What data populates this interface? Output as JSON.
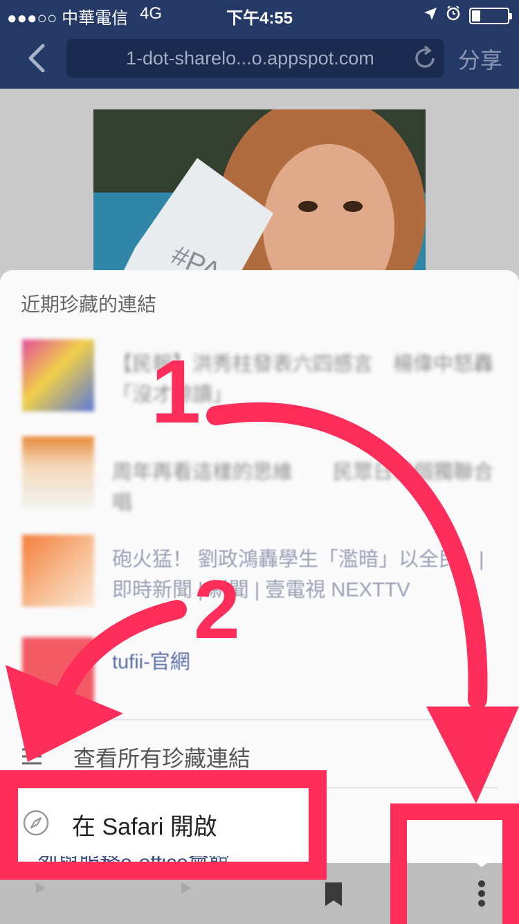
{
  "status_bar": {
    "carrier": "●●●○○ 中華電信",
    "network": "4G",
    "time": "下午4:55"
  },
  "nav": {
    "url": "1-dot-sharelo...o.appspot.com",
    "share_label": "分享"
  },
  "sheet": {
    "title": "近期珍藏的連結",
    "items": [
      {
        "text": "【民報】洪秀柱發表六四感言　楊偉中怒轟「沒才諒讀」"
      },
      {
        "text": "周年再看這樣的思維　　民眾日報個獨聯合唱"
      },
      {
        "text": "砲火猛！ 劉政鴻轟學生「濫暗」以全民」| 即時新聞 | 新聞 | 壹電視 NEXTTV"
      },
      {
        "text": "tufii-官網"
      }
    ],
    "view_all_label": "查看所有珍藏連結",
    "below_text": "烈與服務e-office會館"
  },
  "popup": {
    "safari_label": "在 Safari 開啟"
  },
  "annotations": {
    "step1": "1",
    "step2": "2",
    "color": "#ff2d5a"
  }
}
